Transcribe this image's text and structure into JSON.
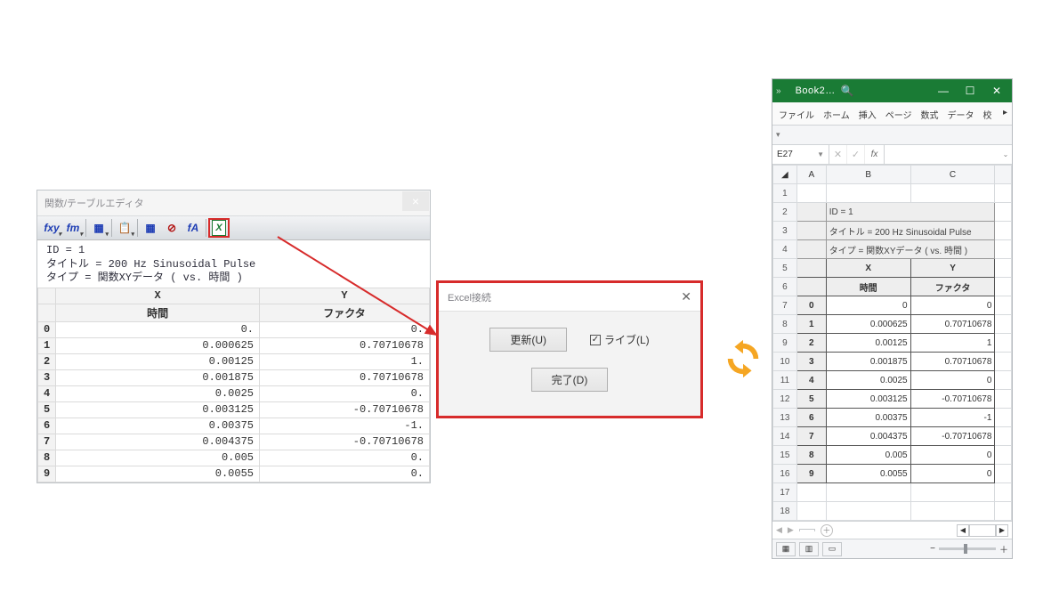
{
  "editor": {
    "title": "関数/テーブルエディタ",
    "meta_id": "ID = 1",
    "meta_title": "タイトル = 200 Hz Sinusoidal Pulse",
    "meta_type": "タイプ = 関数XYデータ ( vs. 時間 )",
    "col_x": "X",
    "col_y": "Y",
    "sub_x": "時間",
    "sub_y": "ファクタ",
    "rows": [
      {
        "i": "0",
        "x": "0.",
        "y": "0."
      },
      {
        "i": "1",
        "x": "0.000625",
        "y": "0.70710678"
      },
      {
        "i": "2",
        "x": "0.00125",
        "y": "1."
      },
      {
        "i": "3",
        "x": "0.001875",
        "y": "0.70710678"
      },
      {
        "i": "4",
        "x": "0.0025",
        "y": "0."
      },
      {
        "i": "5",
        "x": "0.003125",
        "y": "-0.70710678"
      },
      {
        "i": "6",
        "x": "0.00375",
        "y": "-1."
      },
      {
        "i": "7",
        "x": "0.004375",
        "y": "-0.70710678"
      },
      {
        "i": "8",
        "x": "0.005",
        "y": "0."
      },
      {
        "i": "9",
        "x": "0.0055",
        "y": "0."
      }
    ],
    "toolbar_icons": {
      "fn_xy": "fxy",
      "fn_m": "fm",
      "table": "▦",
      "paste": "📋",
      "table2": "▦",
      "del": "⊘",
      "fn_a": "fA",
      "excel": "X"
    }
  },
  "dialog": {
    "title": "Excel接続",
    "update": "更新(U)",
    "live": "ライブ(L)",
    "live_checked": true,
    "done": "完了(D)"
  },
  "excel": {
    "book": "Book2…",
    "tabs": [
      "ファイル",
      "ホーム",
      "挿入",
      "ページ",
      "数式",
      "データ",
      "校"
    ],
    "namebox": "E27",
    "cols": [
      "A",
      "B",
      "C"
    ],
    "info_id": "ID = 1",
    "info_title": "タイトル = 200 Hz Sinusoidal Pulse",
    "info_type": "タイプ = 関数XYデータ ( vs. 時間 )",
    "hdr_x": "X",
    "hdr_y": "Y",
    "sub_x": "時間",
    "sub_y": "ファクタ",
    "rows": [
      {
        "r": "7",
        "i": "0",
        "x": "0",
        "y": "0"
      },
      {
        "r": "8",
        "i": "1",
        "x": "0.000625",
        "y": "0.70710678"
      },
      {
        "r": "9",
        "i": "2",
        "x": "0.00125",
        "y": "1"
      },
      {
        "r": "10",
        "i": "3",
        "x": "0.001875",
        "y": "0.70710678"
      },
      {
        "r": "11",
        "i": "4",
        "x": "0.0025",
        "y": "0"
      },
      {
        "r": "12",
        "i": "5",
        "x": "0.003125",
        "y": "-0.70710678"
      },
      {
        "r": "13",
        "i": "6",
        "x": "0.00375",
        "y": "-1"
      },
      {
        "r": "14",
        "i": "7",
        "x": "0.004375",
        "y": "-0.70710678"
      },
      {
        "r": "15",
        "i": "8",
        "x": "0.005",
        "y": "0"
      },
      {
        "r": "16",
        "i": "9",
        "x": "0.0055",
        "y": "0"
      }
    ],
    "empty_rows": [
      "17",
      "18"
    ],
    "sheet_tab": " "
  },
  "chart_data": {
    "type": "table",
    "title": "200 Hz Sinusoidal Pulse",
    "id": 1,
    "data_type": "関数XYデータ ( vs. 時間 )",
    "xlabel": "時間",
    "ylabel": "ファクタ",
    "x": [
      0,
      0.000625,
      0.00125,
      0.001875,
      0.0025,
      0.003125,
      0.00375,
      0.004375,
      0.005,
      0.0055
    ],
    "y": [
      0,
      0.70710678,
      1,
      0.70710678,
      0,
      -0.70710678,
      -1,
      -0.70710678,
      0,
      0
    ]
  }
}
